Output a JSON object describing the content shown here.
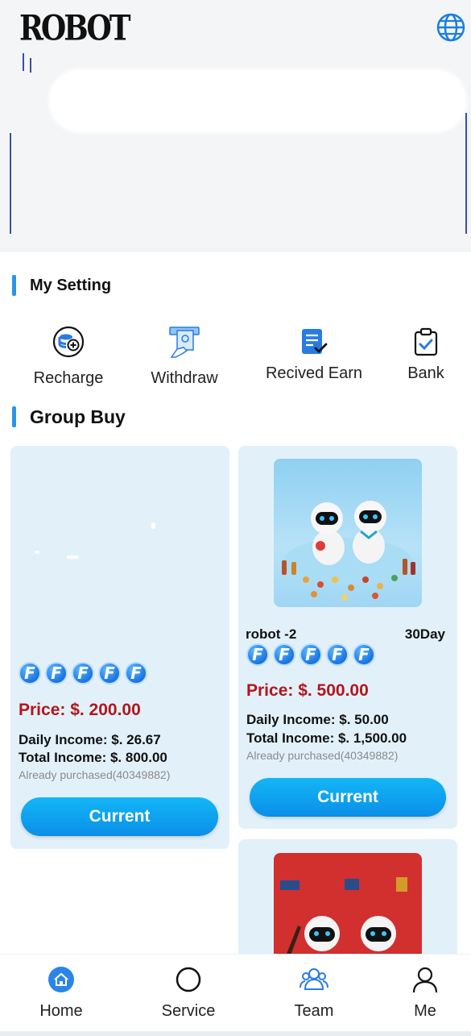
{
  "header": {
    "logo_text": "ROBOT",
    "language_icon": "globe-icon"
  },
  "settings": {
    "title": "My Setting",
    "items": [
      {
        "label": "Recharge",
        "icon": "recharge-coin-icon"
      },
      {
        "label": "Withdraw",
        "icon": "withdraw-atm-icon"
      },
      {
        "label": "Recived Earn",
        "icon": "received-earn-document-icon"
      },
      {
        "label": "Bank",
        "icon": "bank-clipboard-icon"
      }
    ]
  },
  "group_buy": {
    "title": "Group Buy",
    "products": [
      {
        "name": "",
        "days": "",
        "level_badges": [
          "F",
          "F",
          "F",
          "F",
          "F"
        ],
        "price": "Price: $. 200.00",
        "daily_income": "Daily Income: $. 26.67",
        "total_income": "Total Income: $. 800.00",
        "purchased": "Already purchased(40349882)",
        "button_label": "Current"
      },
      {
        "name": "robot -2",
        "days": "30Day",
        "level_badges": [
          "F",
          "F",
          "F",
          "F",
          "F"
        ],
        "price": "Price: $. 500.00",
        "daily_income": "Daily Income: $. 50.00",
        "total_income": "Total Income: $. 1,500.00",
        "purchased": "Already purchased(40349882)",
        "button_label": "Current"
      }
    ]
  },
  "bottom_nav": [
    {
      "label": "Home",
      "icon": "home-icon",
      "active": true
    },
    {
      "label": "Service",
      "icon": "service-circle-icon",
      "active": false
    },
    {
      "label": "Team",
      "icon": "team-icon",
      "active": false
    },
    {
      "label": "Me",
      "icon": "user-icon",
      "active": false
    }
  ],
  "colors": {
    "accent": "#2796e8",
    "price_red": "#b4151b",
    "card_bg": "#e2f1f9",
    "button": "#0a9cee"
  }
}
